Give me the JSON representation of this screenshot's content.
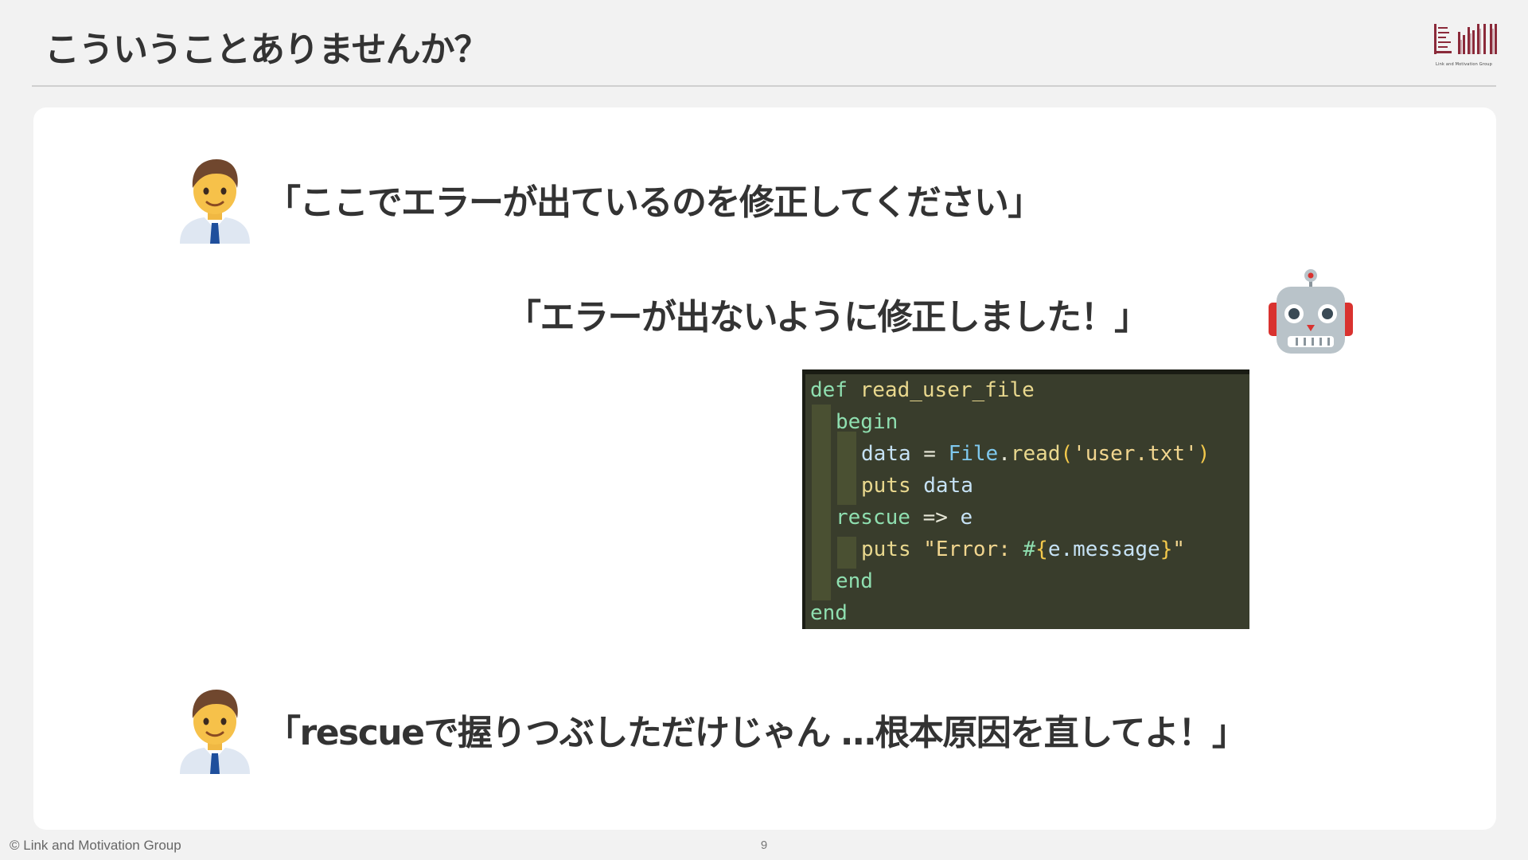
{
  "slide": {
    "title": "こういうことありませんか？",
    "page_number": "9",
    "copyright": "© Link and Motivation Group",
    "logo_caption": "Link and Motivation Group"
  },
  "dialogue": {
    "user_request": "「ここでエラーが出ているのを修正してください」",
    "ai_reply": "「エラーが出ないように修正しました！」",
    "user_complaint": "「rescueで握りつぶしただけじゃん …根本原因を直してよ！」"
  },
  "icons": {
    "user": "man-office-worker-icon",
    "ai": "robot-icon",
    "logo": "lm-logo-icon"
  },
  "code": {
    "l1": {
      "kw": "def",
      "name": "read_user_file"
    },
    "l2": {
      "kw": "begin"
    },
    "l3": {
      "var": "data",
      "eq": "=",
      "cls": "File",
      "dot": ".",
      "method": "read",
      "lp": "(",
      "arg": "'user.txt'",
      "rp": ")"
    },
    "l4": {
      "kw": "puts",
      "arg": "data"
    },
    "l5": {
      "kw": "rescue",
      "arrow": "=>",
      "var": "e"
    },
    "l6": {
      "kw": "puts",
      "str_open": "\"Error: ",
      "hash": "#",
      "lb": "{",
      "expr": "e.message",
      "rb": "}",
      "str_close": "\""
    },
    "l7": {
      "kw": "end"
    },
    "l8": {
      "kw": "end"
    }
  },
  "colors": {
    "code_bg": "#393d2c",
    "keyword": "#8fdfb0",
    "function": "#e9d88e",
    "string": "#f2d68f",
    "class": "#7fc9ef",
    "logo_accent": "#8b2a3a"
  }
}
